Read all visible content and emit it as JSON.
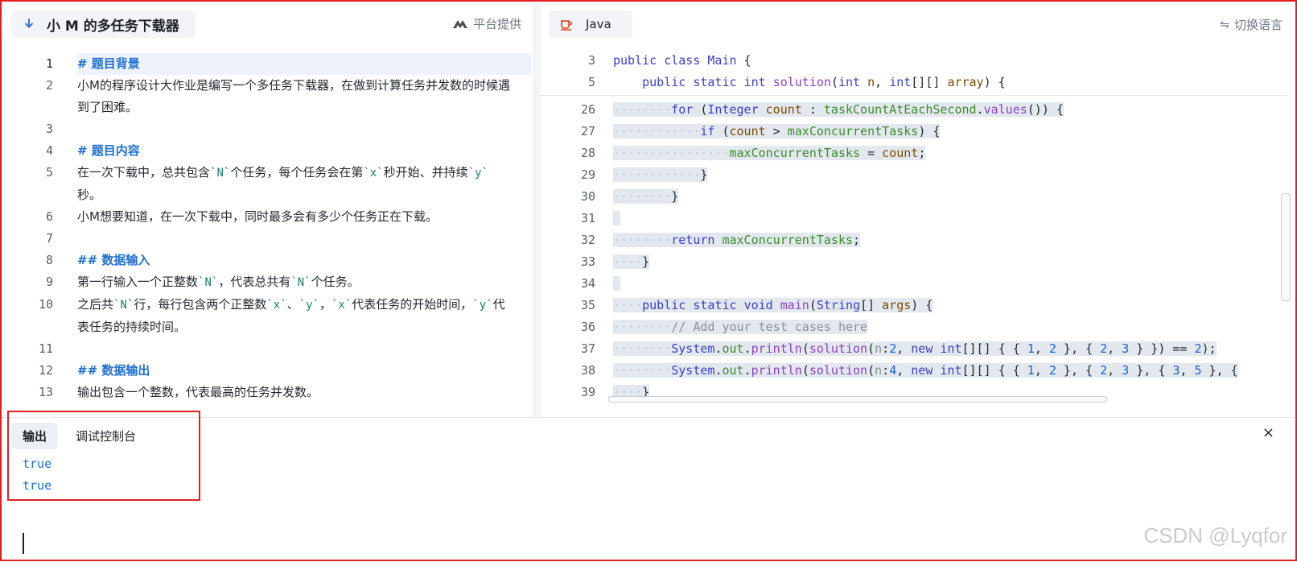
{
  "left": {
    "title": "小 M 的多任务下载器",
    "platform": "平台提供",
    "lines": [
      {
        "n": "1",
        "parts": [
          {
            "t": "# 题目背景",
            "c": "heading"
          }
        ],
        "hl": true
      },
      {
        "n": "2",
        "parts": [
          {
            "t": "小M的程序设计大作业是编写一个多任务下载器，在做到计算任务并发数的时候遇到了困难。"
          }
        ]
      },
      {
        "n": "3",
        "parts": [
          {
            "t": " "
          }
        ]
      },
      {
        "n": "4",
        "parts": [
          {
            "t": "# 题目内容",
            "c": "heading"
          }
        ]
      },
      {
        "n": "5",
        "parts": [
          {
            "t": "在一次下载中，总共包含"
          },
          {
            "t": "`N`",
            "c": "code"
          },
          {
            "t": "个任务，每个任务会在第"
          },
          {
            "t": "`x`",
            "c": "code"
          },
          {
            "t": "秒开始、并持续"
          },
          {
            "t": "`y`",
            "c": "code"
          },
          {
            "t": "秒。"
          }
        ]
      },
      {
        "n": "6",
        "parts": [
          {
            "t": "小M想要知道，在一次下载中，同时最多会有多少个任务正在下载。"
          }
        ]
      },
      {
        "n": "7",
        "parts": [
          {
            "t": " "
          }
        ]
      },
      {
        "n": "8",
        "parts": [
          {
            "t": "## 数据输入",
            "c": "heading"
          }
        ]
      },
      {
        "n": "9",
        "parts": [
          {
            "t": "第一行输入一个正整数"
          },
          {
            "t": "`N`",
            "c": "code"
          },
          {
            "t": "，代表总共有"
          },
          {
            "t": "`N`",
            "c": "code"
          },
          {
            "t": "个任务。"
          }
        ]
      },
      {
        "n": "10",
        "parts": [
          {
            "t": "之后共"
          },
          {
            "t": "`N`",
            "c": "code"
          },
          {
            "t": "行，每行包含两个正整数"
          },
          {
            "t": "`x`",
            "c": "code"
          },
          {
            "t": "、"
          },
          {
            "t": "`y`",
            "c": "code"
          },
          {
            "t": "，"
          },
          {
            "t": "`x`",
            "c": "code"
          },
          {
            "t": "代表任务的开始时间，"
          },
          {
            "t": "`y`",
            "c": "code"
          },
          {
            "t": "代表任务的持续时间。"
          }
        ]
      },
      {
        "n": "11",
        "parts": [
          {
            "t": " "
          }
        ]
      },
      {
        "n": "12",
        "parts": [
          {
            "t": "## 数据输出",
            "c": "heading"
          }
        ]
      },
      {
        "n": "13",
        "parts": [
          {
            "t": "输出包含一个整数，代表最高的任务并发数。"
          }
        ]
      }
    ]
  },
  "right": {
    "language": "Java",
    "switch_label": "切换语言",
    "sticky": [
      {
        "n": "3",
        "indent": 0,
        "tokens": [
          [
            "public",
            "kw"
          ],
          [
            " ",
            ""
          ],
          [
            "class",
            "kw"
          ],
          [
            " ",
            ""
          ],
          [
            "Main",
            "ty"
          ],
          [
            " {",
            ""
          ]
        ]
      },
      {
        "n": "5",
        "indent": 1,
        "tokens": [
          [
            "public",
            "kw"
          ],
          [
            " ",
            ""
          ],
          [
            "static",
            "kw"
          ],
          [
            " ",
            ""
          ],
          [
            "int",
            "kw"
          ],
          [
            " ",
            ""
          ],
          [
            "solution",
            "fn"
          ],
          [
            "(",
            ""
          ],
          [
            "int",
            "kw"
          ],
          [
            " ",
            ""
          ],
          [
            "n",
            "vr"
          ],
          [
            ", ",
            ""
          ],
          [
            "int",
            "kw"
          ],
          [
            "[][] ",
            ""
          ],
          [
            "array",
            "vr"
          ],
          [
            ") {",
            ""
          ]
        ]
      }
    ],
    "code": [
      {
        "n": "26",
        "dots": 8,
        "tokens": [
          [
            "for",
            "kw"
          ],
          [
            " (",
            ""
          ],
          [
            "Integer",
            "ty"
          ],
          [
            " ",
            ""
          ],
          [
            "count",
            "vr"
          ],
          [
            " : ",
            ""
          ],
          [
            "taskCountAtEachSecond",
            "fd"
          ],
          [
            ".",
            ""
          ],
          [
            "values",
            "fn"
          ],
          [
            "()) {",
            ""
          ]
        ]
      },
      {
        "n": "27",
        "dots": 12,
        "tokens": [
          [
            "if",
            "kw"
          ],
          [
            " (",
            ""
          ],
          [
            "count",
            "vr"
          ],
          [
            " > ",
            ""
          ],
          [
            "maxConcurrentTasks",
            "fd"
          ],
          [
            ") {",
            ""
          ]
        ]
      },
      {
        "n": "28",
        "dots": 16,
        "tokens": [
          [
            "maxConcurrentTasks",
            "fd"
          ],
          [
            " = ",
            ""
          ],
          [
            "count",
            "vr"
          ],
          [
            ";",
            ""
          ]
        ]
      },
      {
        "n": "29",
        "dots": 12,
        "tokens": [
          [
            "}",
            ""
          ]
        ]
      },
      {
        "n": "30",
        "dots": 8,
        "tokens": [
          [
            "}",
            ""
          ]
        ]
      },
      {
        "n": "31",
        "dots": 0,
        "tokens": [
          [
            " ",
            ""
          ]
        ]
      },
      {
        "n": "32",
        "dots": 8,
        "tokens": [
          [
            "return",
            "kw"
          ],
          [
            " ",
            ""
          ],
          [
            "maxConcurrentTasks",
            "fd"
          ],
          [
            ";",
            ""
          ]
        ]
      },
      {
        "n": "33",
        "dots": 4,
        "tokens": [
          [
            "}",
            ""
          ]
        ]
      },
      {
        "n": "34",
        "dots": 0,
        "tokens": [
          [
            " ",
            ""
          ]
        ]
      },
      {
        "n": "35",
        "dots": 4,
        "tokens": [
          [
            "public",
            "kw"
          ],
          [
            " ",
            ""
          ],
          [
            "static",
            "kw"
          ],
          [
            " ",
            ""
          ],
          [
            "void",
            "kw"
          ],
          [
            " ",
            ""
          ],
          [
            "main",
            "fn"
          ],
          [
            "(",
            ""
          ],
          [
            "String",
            "ty"
          ],
          [
            "[] ",
            ""
          ],
          [
            "args",
            "vr"
          ],
          [
            ") {",
            ""
          ]
        ]
      },
      {
        "n": "36",
        "dots": 8,
        "tokens": [
          [
            "// Add your test cases here",
            "cm"
          ]
        ]
      },
      {
        "n": "37",
        "dots": 8,
        "tokens": [
          [
            "System",
            "ty"
          ],
          [
            ".",
            ""
          ],
          [
            "out",
            "fd"
          ],
          [
            ".",
            ""
          ],
          [
            "println",
            "fn"
          ],
          [
            "(",
            ""
          ],
          [
            "solution",
            "fn"
          ],
          [
            "(",
            ""
          ],
          [
            "n",
            "cm"
          ],
          [
            ":",
            ""
          ],
          [
            "2",
            "num"
          ],
          [
            ", ",
            ""
          ],
          [
            "new",
            "kw"
          ],
          [
            " ",
            ""
          ],
          [
            "int",
            "kw"
          ],
          [
            "[][] { { ",
            ""
          ],
          [
            "1",
            "num"
          ],
          [
            ", ",
            ""
          ],
          [
            "2",
            "num"
          ],
          [
            " }, { ",
            ""
          ],
          [
            "2",
            "num"
          ],
          [
            ", ",
            ""
          ],
          [
            "3",
            "num"
          ],
          [
            " } }) == ",
            ""
          ],
          [
            "2",
            "num"
          ],
          [
            ");",
            ""
          ]
        ]
      },
      {
        "n": "38",
        "dots": 8,
        "tokens": [
          [
            "System",
            "ty"
          ],
          [
            ".",
            ""
          ],
          [
            "out",
            "fd"
          ],
          [
            ".",
            ""
          ],
          [
            "println",
            "fn"
          ],
          [
            "(",
            ""
          ],
          [
            "solution",
            "fn"
          ],
          [
            "(",
            ""
          ],
          [
            "n",
            "cm"
          ],
          [
            ":",
            ""
          ],
          [
            "4",
            "num"
          ],
          [
            ", ",
            ""
          ],
          [
            "new",
            "kw"
          ],
          [
            " ",
            ""
          ],
          [
            "int",
            "kw"
          ],
          [
            "[][] { { ",
            ""
          ],
          [
            "1",
            "num"
          ],
          [
            ", ",
            ""
          ],
          [
            "2",
            "num"
          ],
          [
            " }, { ",
            ""
          ],
          [
            "2",
            "num"
          ],
          [
            ", ",
            ""
          ],
          [
            "3",
            "num"
          ],
          [
            " }, { ",
            ""
          ],
          [
            "3",
            "num"
          ],
          [
            ", ",
            ""
          ],
          [
            "5",
            "num"
          ],
          [
            " }, {",
            ""
          ]
        ]
      },
      {
        "n": "39",
        "dots": 4,
        "tokens": [
          [
            "}",
            ""
          ]
        ]
      }
    ]
  },
  "output": {
    "tab_output": "输出",
    "tab_debug": "调试控制台",
    "close": "×",
    "lines": [
      "true",
      "true"
    ]
  },
  "watermark": "CSDN @Lyqfor"
}
